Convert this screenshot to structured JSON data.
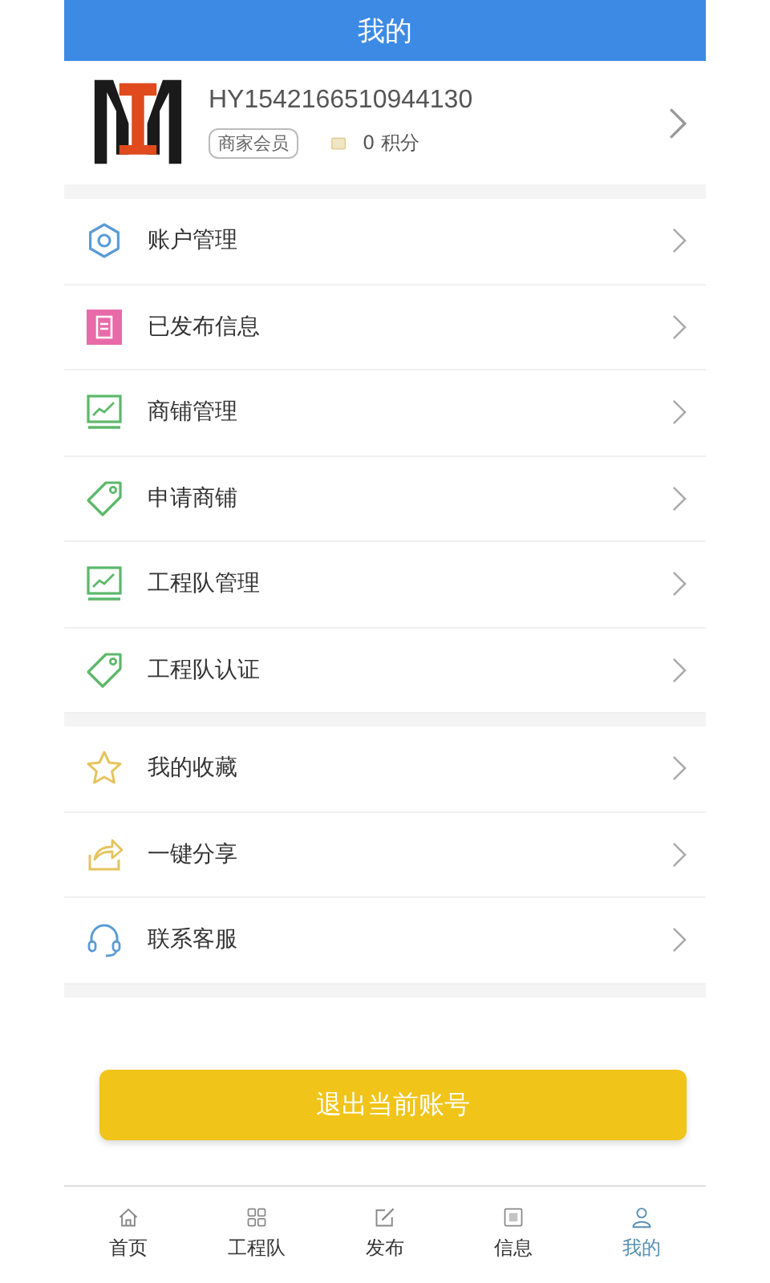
{
  "header": {
    "title": "我的"
  },
  "profile": {
    "username": "HY1542166510944130",
    "badge": "商家会员",
    "points": "0 积分"
  },
  "menu_groups": [
    {
      "items": [
        {
          "label": "账户管理",
          "kind": "gear"
        },
        {
          "label": "已发布信息",
          "kind": "document"
        },
        {
          "label": "商铺管理",
          "kind": "chart"
        },
        {
          "label": "申请商铺",
          "kind": "tag"
        },
        {
          "label": "工程队管理",
          "kind": "chart"
        },
        {
          "label": "工程队认证",
          "kind": "tag"
        }
      ]
    },
    {
      "items": [
        {
          "label": "我的收藏",
          "kind": "star"
        },
        {
          "label": "一键分享",
          "kind": "share"
        },
        {
          "label": "联系客服",
          "kind": "headset"
        }
      ]
    }
  ],
  "logout_button": "退出当前账号",
  "tab_bar": [
    {
      "label": "首页",
      "kind": "home",
      "selected": false
    },
    {
      "label": "工程队",
      "kind": "grid",
      "selected": false
    },
    {
      "label": "发布",
      "kind": "edit",
      "selected": false
    },
    {
      "label": "信息",
      "kind": "news",
      "selected": false
    },
    {
      "label": "我的",
      "kind": "person",
      "selected": true
    }
  ]
}
